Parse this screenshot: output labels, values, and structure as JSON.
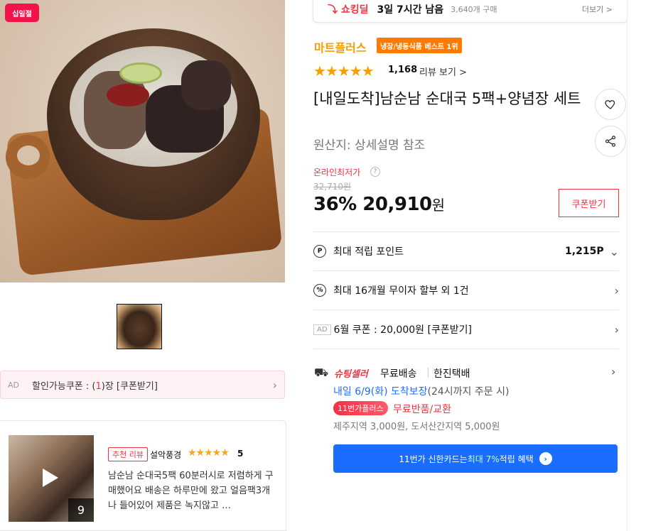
{
  "hero": {
    "badge": "십일절"
  },
  "coupon_bar": {
    "ad": "AD",
    "prefix": "할인가능쿠폰 : (",
    "count": "1",
    "suffix": ")장 [쿠폰받기]"
  },
  "review": {
    "tag": "추천 리뷰",
    "user": "설악풍경",
    "stars": "★★★★★",
    "score": "5",
    "text": "남순남 순대국5팩 60분러시로 저렴하게 구매했어요 배송은 하루만에 왔고 얼음팩3개나 들어있어 제품은 녹지않고 …",
    "media_count": "9"
  },
  "deal": {
    "logo": "쇼킹딜",
    "time_left": "3일 7시간 남음",
    "purchases": "3,640개 구매",
    "more": "더보기 >"
  },
  "store": {
    "name": "마트플러스",
    "best": "냉장/냉동식품 베스트 1위"
  },
  "rating": {
    "stars": "★★★★★",
    "value": 4.5,
    "count": "1,168",
    "link": "리뷰 보기 >"
  },
  "product": {
    "title": "[내일도착]남순남 순대국 5팩+양념장 세트",
    "origin": "원산지:  상세설명 참조"
  },
  "price": {
    "lowest_label": "온라인최저가",
    "original": "32,710원",
    "discount": "36%",
    "amount": "20,910",
    "currency": "원",
    "coupon_button": "쿠폰받기"
  },
  "rows": {
    "points_label": "최대 적립 포인트",
    "points_value": "1,215P",
    "installment_label": "최대 16개월 무이자 할부 외 1건",
    "ad_tag": "AD",
    "coupon_label": "6월 쿠폰 : 20,000원 [쿠폰받기]"
  },
  "shipping": {
    "brand": "슈팅셀러",
    "free": "무료배송",
    "courier": "한진택배",
    "arrive": "내일 6/9(화) 도착보장",
    "arrive_note": "(24시까지 주문 시)",
    "plus_badge": "11번가플러스",
    "return": "무료반품/교환",
    "extra_fee": "제주지역 3,000원, 도서산간지역 5,000원"
  },
  "card_banner": {
    "prefix": "11번가 신한카드는 ",
    "highlight": "최대 7%",
    "suffix": " 적립 혜택"
  },
  "colors": {
    "accent": "#f43142",
    "store": "#f5a000",
    "blue": "#1a6dff",
    "best": "#ff7a00"
  }
}
